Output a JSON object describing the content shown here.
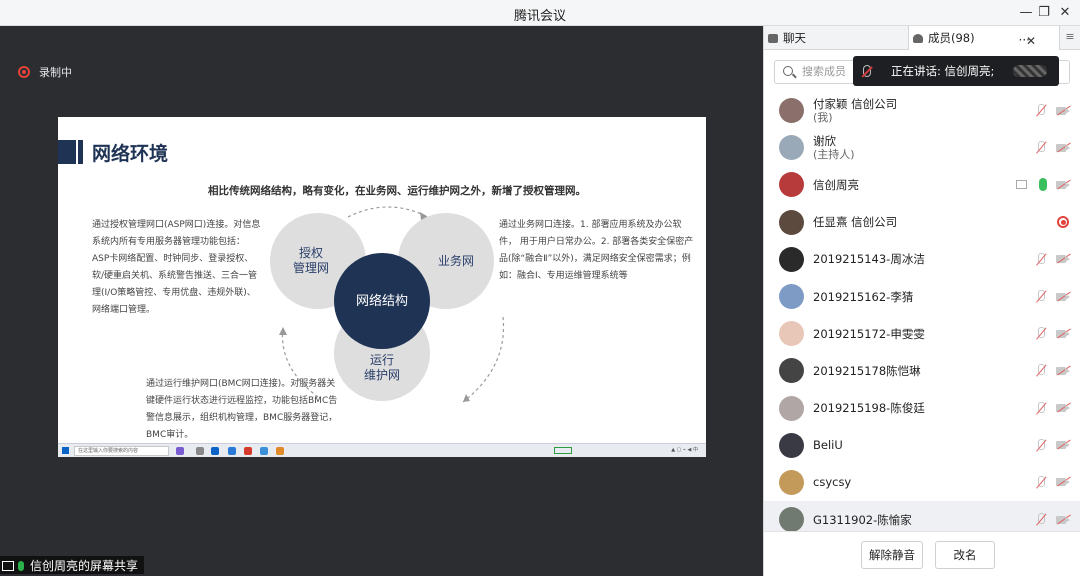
{
  "window": {
    "title": "腾讯会议"
  },
  "recording": {
    "label": "录制中"
  },
  "share": {
    "label": "信创周亮的屏幕共享"
  },
  "slide": {
    "title": "网络环境",
    "subtitle": "相比传统网络结构，略有变化，在业务网、运行维护网之外，新增了授权管理网。",
    "left_text": "通过授权管理网口(ASP网口)连接。对信息系统内所有专用服务器管理功能包括：ASP卡网络配置、时钟同步、登录授权、软/硬重启关机、系统警告推送、三合一管理(I/O策略管控、专用优盘、违规外联)、网络端口管理。",
    "right_text": "通过业务网口连接。1. 部署应用系统及办公软件， 用于用户日常办公。2. 部署各类安全保密产品(除“融合Ⅱ”以外)，满足网络安全保密需求；例如：融合Ⅰ、专用运维管理系统等",
    "bottom_text": "通过运行维护网口(BMC网口连接)。对服务器关键硬件运行状态进行远程监控，功能包括BMC告警信息展示，组织机构管理，BMC服务器登记，BMC审计。",
    "circle_auth": "授权\n管理网",
    "circle_biz": "业务网",
    "circle_core": "网络结构",
    "circle_ops": "运行\n维护网",
    "taskbar_search": "在这里输入你要搜索的内容"
  },
  "panel": {
    "tab_chat": "聊天",
    "tab_members": "成员(98)",
    "search_placeholder": "搜索成员",
    "speaking": "正在讲话: 信创周亮;"
  },
  "members": [
    {
      "name": "付家颖 信创公司",
      "role": "(我)",
      "status": "muted",
      "avatar": "#8a6f6a"
    },
    {
      "name": "谢欣",
      "role": "(主持人)",
      "status": "muted",
      "avatar": "#9aa9b8"
    },
    {
      "name": "信创周亮",
      "role": "",
      "status": "speaking",
      "avatar": "#b83b3b"
    },
    {
      "name": "任显熹 信创公司",
      "role": "",
      "status": "recording",
      "avatar": "#5d4a3e"
    },
    {
      "name": "2019215143-周冰洁",
      "role": "",
      "status": "muted",
      "avatar": "#2a2a2a"
    },
    {
      "name": "2019215162-李猜",
      "role": "",
      "status": "muted",
      "avatar": "#7d9bc4"
    },
    {
      "name": "2019215172-申雯雯",
      "role": "",
      "status": "muted",
      "avatar": "#e8c6b8"
    },
    {
      "name": "2019215178陈恺琳",
      "role": "",
      "status": "muted",
      "avatar": "#444444"
    },
    {
      "name": "2019215198-陈俊廷",
      "role": "",
      "status": "muted",
      "avatar": "#b0a6a6"
    },
    {
      "name": "BeliU",
      "role": "",
      "status": "muted",
      "avatar": "#3a3a44"
    },
    {
      "name": "csycsy",
      "role": "",
      "status": "muted",
      "avatar": "#c49a5a"
    },
    {
      "name": "G1311902-陈愉家",
      "role": "",
      "status": "muted",
      "avatar": "#707a70"
    }
  ],
  "footer": {
    "unmute": "解除静音",
    "rename": "改名"
  }
}
